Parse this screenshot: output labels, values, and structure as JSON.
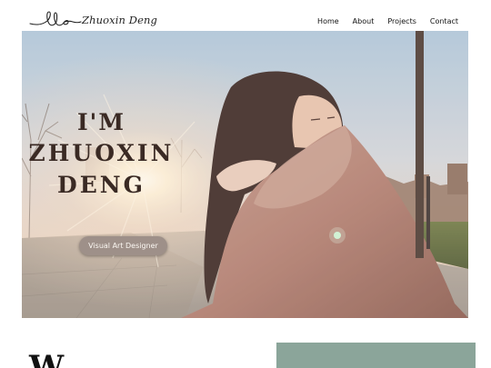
{
  "header": {
    "brand": "Zhuoxin Deng",
    "logo_icon": "signature-logo-icon",
    "menu": [
      "Home",
      "About",
      "Projects",
      "Contact"
    ]
  },
  "hero": {
    "headline_line1": "I'M",
    "headline_line2": "ZHUOXIN",
    "headline_line3": "DENG",
    "role_button": "Visual Art Designer"
  },
  "section": {
    "heading_fragment": "W"
  },
  "colors": {
    "accent_green": "#8ba59a",
    "pill_bg": "#9e9089",
    "headline_text": "#3a2a24"
  }
}
